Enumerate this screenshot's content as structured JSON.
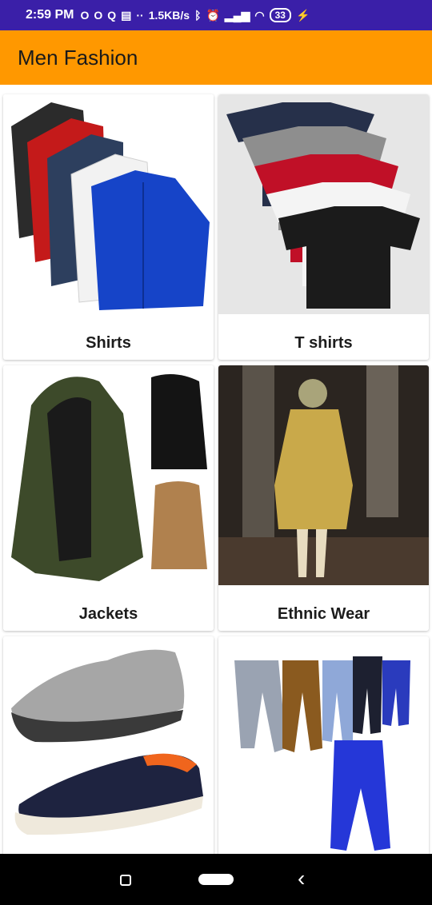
{
  "status_bar": {
    "time": "2:59 PM",
    "net_speed": "1.5KB/s",
    "battery": "33",
    "icons": [
      "opera-icon",
      "opera-icon",
      "q-icon",
      "calendar-icon",
      "dots-icon",
      "bluetooth-icon",
      "alarm-icon",
      "volte-icon",
      "signal-icon",
      "signal-icon",
      "wifi-icon",
      "wifi-icon",
      "battery-icon",
      "charging-icon"
    ]
  },
  "toolbar": {
    "title": "Men Fashion"
  },
  "categories": [
    {
      "label": "Shirts",
      "image_icon": "shirts-image"
    },
    {
      "label": "T shirts",
      "image_icon": "tshirts-image"
    },
    {
      "label": "Jackets",
      "image_icon": "jackets-image"
    },
    {
      "label": "Ethnic Wear",
      "image_icon": "ethnic-wear-image"
    },
    {
      "label": "",
      "image_icon": "shoes-image"
    },
    {
      "label": "",
      "image_icon": "jeans-image"
    }
  ],
  "colors": {
    "status_bar": "#3a1fa8",
    "toolbar": "#ff9800",
    "nav_bar": "#000000"
  }
}
